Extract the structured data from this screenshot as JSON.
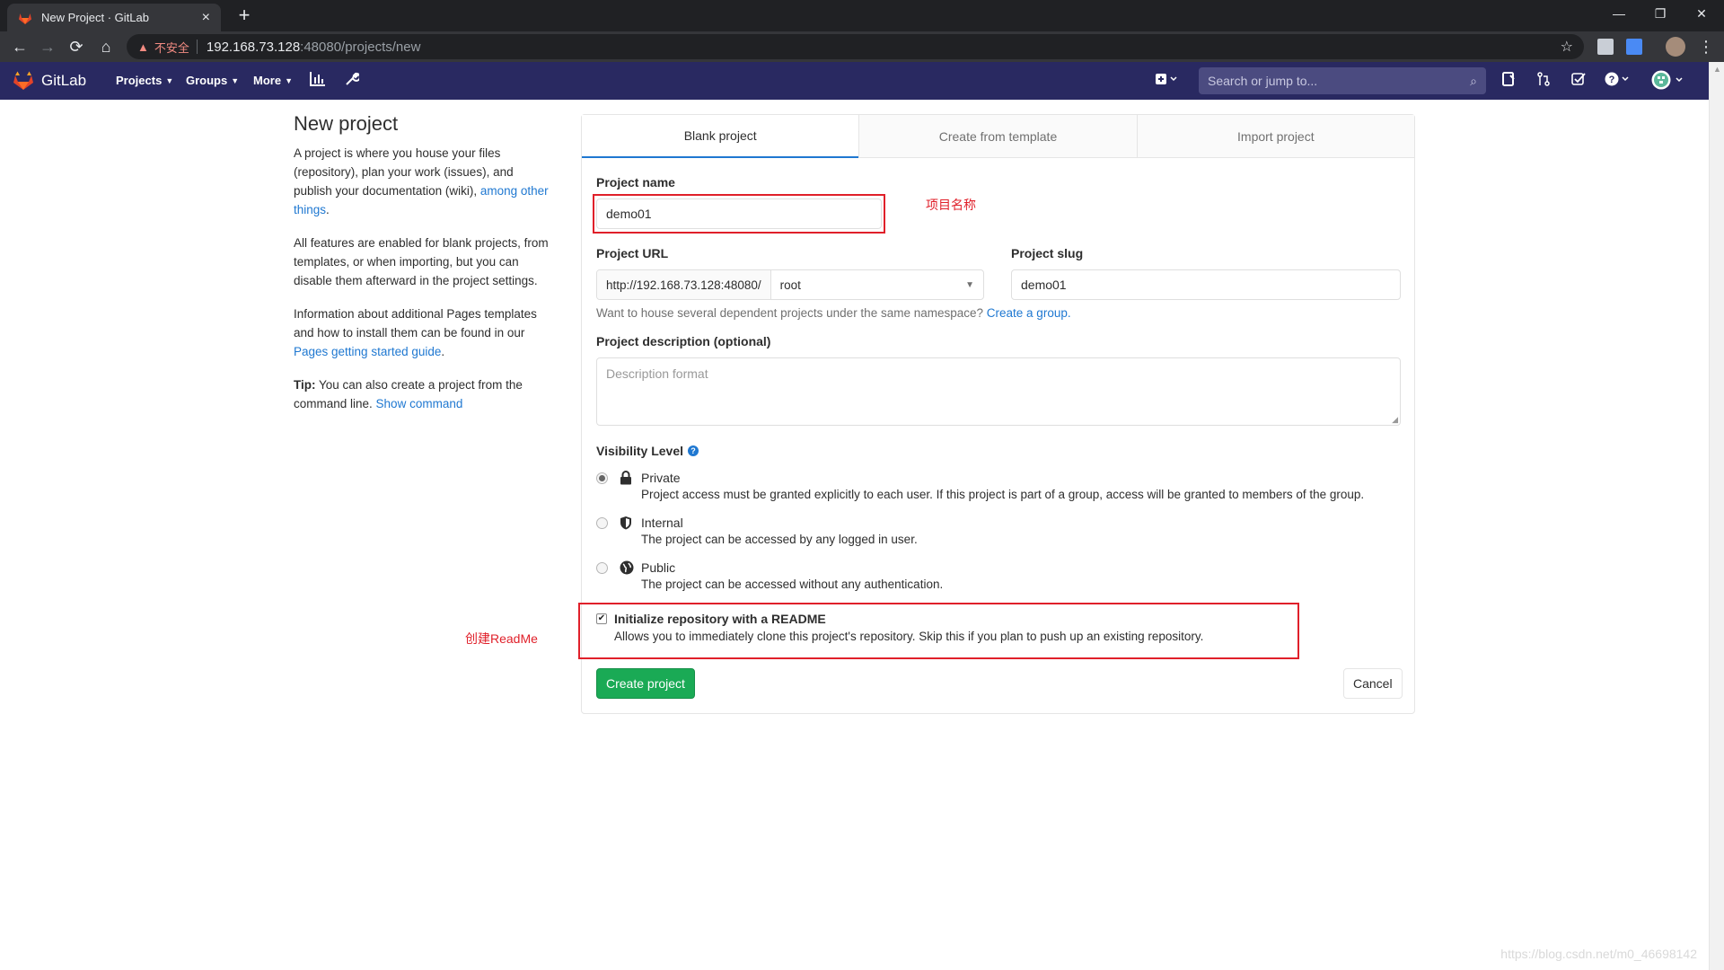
{
  "browser": {
    "tab_title": "New Project · GitLab",
    "tab_close": "×",
    "new_tab": "+",
    "insecure_label": "不安全",
    "url_host": "192.168.73.128",
    "url_path": ":48080/projects/new",
    "window_controls": {
      "minimize": "—",
      "restore": "❐",
      "close": "✕"
    }
  },
  "gitlab": {
    "brand": "GitLab",
    "nav": [
      {
        "label": "Projects",
        "caret": "▼"
      },
      {
        "label": "Groups",
        "caret": "▼"
      },
      {
        "label": "More",
        "caret": "▼"
      }
    ],
    "search_placeholder": "Search or jump to...",
    "colors": {
      "header": "#292961",
      "accent": "#1f78d1",
      "success": "#1aaa55",
      "annotation": "#e0202a"
    }
  },
  "info": {
    "title": "New project",
    "p1_text": "A project is where you house your files (repository), plan your work (issues), and publish your documentation (wiki), ",
    "p1_link": "among other things",
    "p1_end": ".",
    "p2": "All features are enabled for blank projects, from templates, or when importing, but you can disable them afterward in the project settings.",
    "p3_text": "Information about additional Pages templates and how to install them can be found in our ",
    "p3_link": "Pages getting started guide",
    "p3_end": ".",
    "tip_label": "Tip:",
    "tip_text": " You can also create a project from the command line. ",
    "tip_link": "Show command"
  },
  "form": {
    "tabs": [
      "Blank project",
      "Create from template",
      "Import project"
    ],
    "project_name_label": "Project name",
    "project_name_value": "demo01",
    "project_url_label": "Project URL",
    "project_url_prefix": "http://192.168.73.128:48080/",
    "namespace_value": "root",
    "project_slug_label": "Project slug",
    "project_slug_value": "demo01",
    "namespace_help": "Want to house several dependent projects under the same namespace? ",
    "namespace_help_link": "Create a group.",
    "description_label": "Project description (optional)",
    "description_placeholder": "Description format",
    "visibility_label": "Visibility Level",
    "visibility": [
      {
        "title": "Private",
        "desc": "Project access must be granted explicitly to each user. If this project is part of a group, access will be granted to members of the group.",
        "selected": true,
        "icon": "lock-icon"
      },
      {
        "title": "Internal",
        "desc": "The project can be accessed by any logged in user.",
        "selected": false,
        "icon": "shield-icon"
      },
      {
        "title": "Public",
        "desc": "The project can be accessed without any authentication.",
        "selected": false,
        "icon": "globe-icon"
      }
    ],
    "readme_label": "Initialize repository with a README",
    "readme_desc": "Allows you to immediately clone this project's repository. Skip this if you plan to push up an existing repository.",
    "readme_checked": true,
    "create_button": "Create project",
    "cancel_button": "Cancel"
  },
  "annotations": {
    "project_name_note": "项目名称",
    "readme_note": "创建ReadMe"
  },
  "watermark": "https://blog.csdn.net/m0_46698142"
}
